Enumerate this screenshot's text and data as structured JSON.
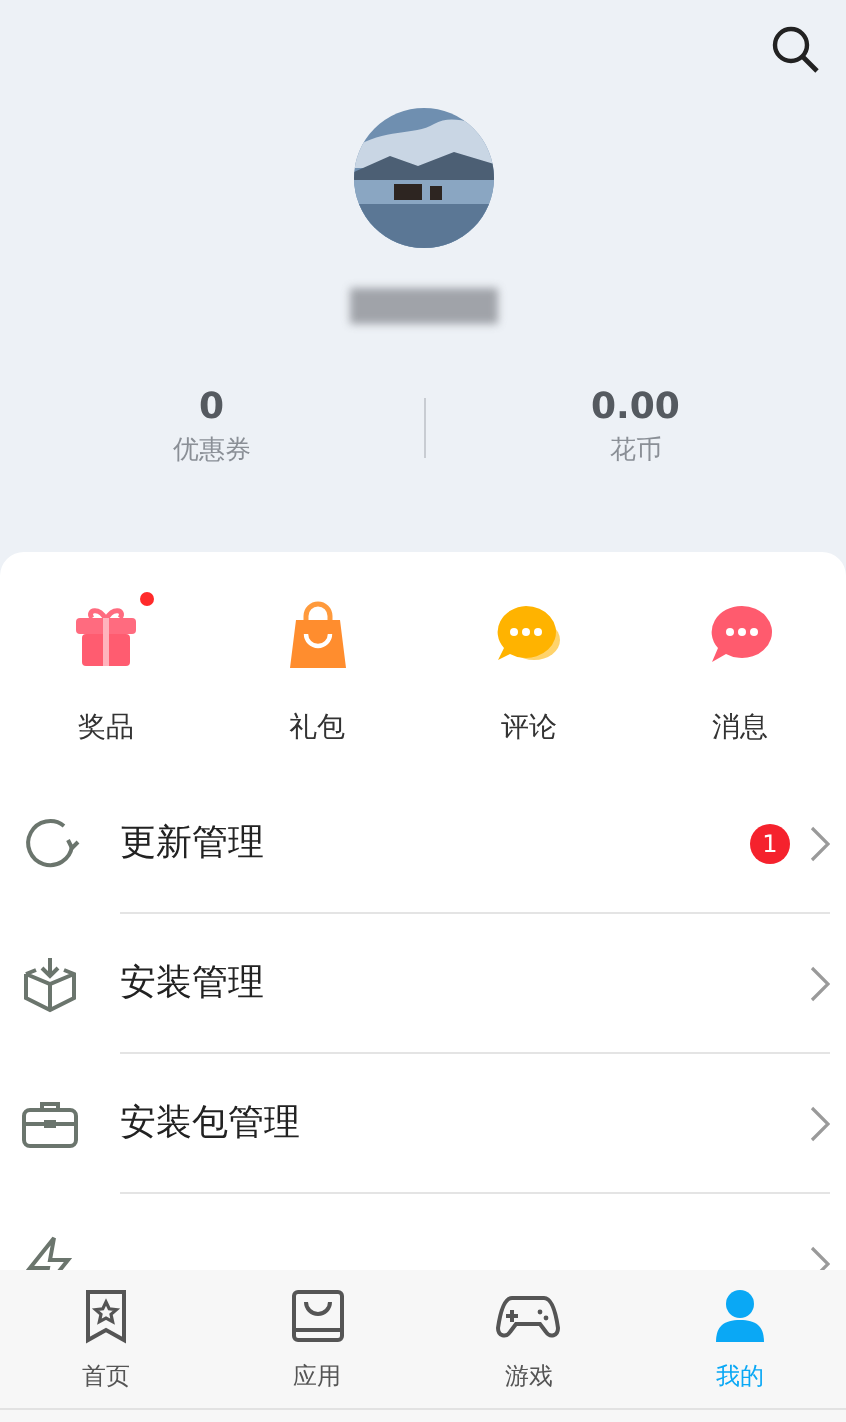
{
  "profile": {
    "stats": [
      {
        "value": "0",
        "label": "优惠券"
      },
      {
        "value": "0.00",
        "label": "花币"
      }
    ]
  },
  "shortcuts": [
    {
      "kind": "gift",
      "label": "奖品",
      "dot": true
    },
    {
      "kind": "bag",
      "label": "礼包",
      "dot": false
    },
    {
      "kind": "comment",
      "label": "评论",
      "dot": false
    },
    {
      "kind": "message",
      "label": "消息",
      "dot": false
    }
  ],
  "menu": [
    {
      "kind": "update",
      "label": "更新管理",
      "badge": "1"
    },
    {
      "kind": "install",
      "label": "安装管理"
    },
    {
      "kind": "package",
      "label": "安装包管理"
    },
    {
      "kind": "quickapp"
    }
  ],
  "tabs": [
    {
      "kind": "home",
      "label": "首页",
      "selected": false
    },
    {
      "kind": "apps",
      "label": "应用",
      "selected": false
    },
    {
      "kind": "games",
      "label": "游戏",
      "selected": false
    },
    {
      "kind": "mine",
      "label": "我的",
      "selected": true
    }
  ]
}
